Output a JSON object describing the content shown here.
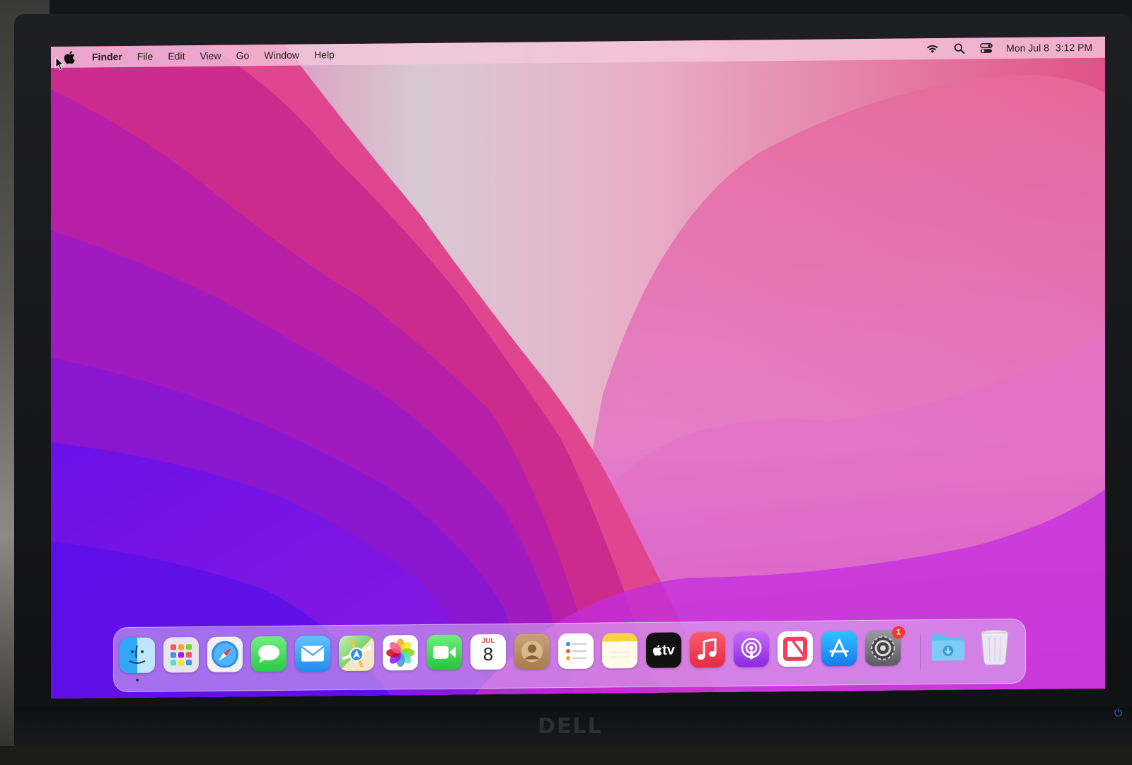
{
  "menubar": {
    "app_name": "Finder",
    "items": [
      "File",
      "Edit",
      "View",
      "Go",
      "Window",
      "Help"
    ],
    "clock_date": "Mon Jul 8",
    "clock_time": "3:12 PM",
    "status_icons": [
      "wifi-icon",
      "spotlight-search-icon",
      "control-center-icon"
    ]
  },
  "dock": {
    "apps": [
      {
        "name": "finder",
        "running": true
      },
      {
        "name": "launchpad"
      },
      {
        "name": "safari"
      },
      {
        "name": "messages"
      },
      {
        "name": "mail"
      },
      {
        "name": "maps"
      },
      {
        "name": "photos"
      },
      {
        "name": "facetime"
      },
      {
        "name": "calendar",
        "month": "JUL",
        "day": "8"
      },
      {
        "name": "contacts"
      },
      {
        "name": "reminders"
      },
      {
        "name": "notes"
      },
      {
        "name": "apple-tv",
        "label": "tv"
      },
      {
        "name": "music"
      },
      {
        "name": "podcasts"
      },
      {
        "name": "news"
      },
      {
        "name": "app-store"
      },
      {
        "name": "system-preferences",
        "badge": "1"
      },
      {
        "name": "downloads-folder"
      },
      {
        "name": "trash"
      }
    ]
  },
  "monitor": {
    "brand": "DELL"
  },
  "colors": {
    "menubar_bg": "#f5c8de",
    "wallpaper_purple": "#7a1ae0",
    "wallpaper_magenta": "#c22fd0",
    "wallpaper_pink": "#e86aa8",
    "badge_red": "#f23b30"
  }
}
